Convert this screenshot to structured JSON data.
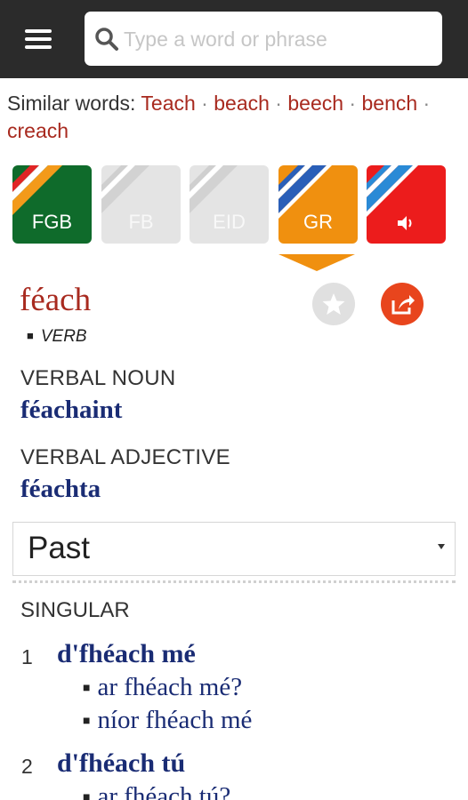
{
  "search": {
    "placeholder": "Type a word or phrase"
  },
  "similar": {
    "label": "Similar words:",
    "separator": "·",
    "words": [
      "Teach",
      "beach",
      "beech",
      "bench",
      "creach"
    ]
  },
  "dictionary_tabs": [
    {
      "label": "FGB",
      "color": "#0f6b2b",
      "active": true
    },
    {
      "label": "FB",
      "color": "#e4e4e4",
      "active": false
    },
    {
      "label": "EID",
      "color": "#e4e4e4",
      "active": false
    },
    {
      "label": "GR",
      "color": "#f0900f",
      "active": true,
      "selected": true
    },
    {
      "label": "",
      "icon": "speaker-icon",
      "color": "#ec1c1c",
      "active": true
    }
  ],
  "entry": {
    "headword": "féach",
    "part_of_speech": "VERB",
    "verbal_noun_label": "VERBAL NOUN",
    "verbal_noun": "féachaint",
    "verbal_adjective_label": "VERBAL ADJECTIVE",
    "verbal_adjective": "féachta"
  },
  "tense": {
    "selected": "Past"
  },
  "conjugation": {
    "section_label": "SINGULAR",
    "persons": [
      {
        "num": "1",
        "form": "d'fhéach mé",
        "question": "ar fhéach mé?",
        "negative": "níor fhéach mé"
      },
      {
        "num": "2",
        "form": "d'fhéach tú",
        "question": "ar fhéach tú?"
      }
    ]
  },
  "colors": {
    "topbar": "#2b2b2b",
    "link_red": "#a82a1f",
    "form_blue": "#1a2c74",
    "share": "#e8451d"
  }
}
